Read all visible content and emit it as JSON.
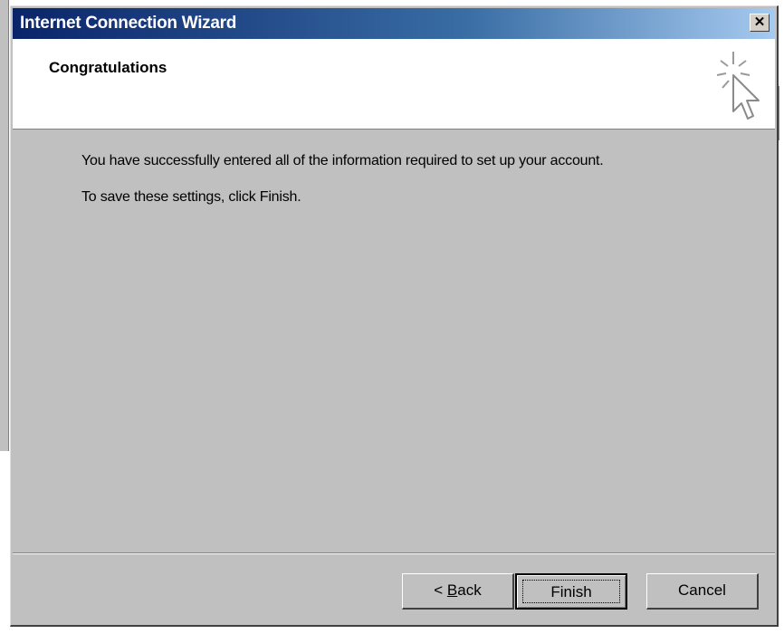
{
  "window": {
    "title": "Internet Connection Wizard",
    "close_glyph": "✕",
    "titlebar_color": "#0a246a"
  },
  "header": {
    "title": "Congratulations",
    "icon": "wizard-cursor-sparkle-icon"
  },
  "content": {
    "paragraph1": "You have successfully entered all of the information required to set up your account.",
    "paragraph2": "To save these settings, click Finish."
  },
  "buttons": {
    "back_prefix": "< ",
    "back_mnemonic": "B",
    "back_rest": "ack",
    "finish": "Finish",
    "cancel": "Cancel"
  }
}
